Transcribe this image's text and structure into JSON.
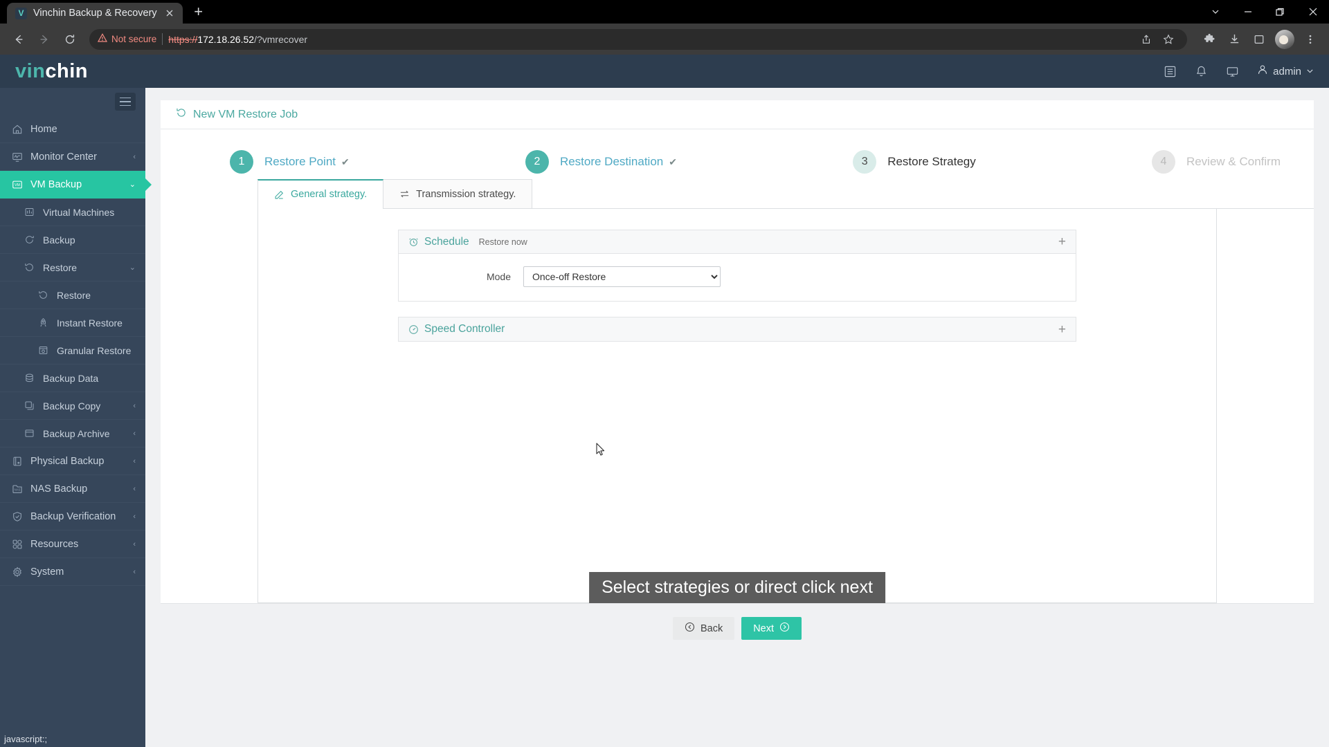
{
  "browser": {
    "tab": {
      "title": "Vinchin Backup & Recovery",
      "favicon_letter": "V",
      "favicon_icon": "vinchin-favicon",
      "close_icon": "close-icon"
    },
    "new_tab_icon": "new-tab-icon",
    "window_controls": {
      "tab_search_icon": "tab-search-icon",
      "minimize_icon": "minimize-icon",
      "maximize_icon": "maximize-icon",
      "close_icon": "window-close-icon"
    },
    "nav": {
      "back_icon": "back-arrow-icon",
      "forward_icon": "forward-arrow-icon",
      "reload_icon": "reload-icon"
    },
    "omnibox": {
      "warning_icon": "not-secure-warning-icon",
      "security_label": "Not secure",
      "url_scheme": "https://",
      "url_host": "172.18.26.52",
      "url_path": "/?vmrecover",
      "share_icon": "share-icon",
      "bookmark_icon": "bookmark-star-icon"
    },
    "toolbar_icons": [
      "extensions-puzzle-icon",
      "downloads-icon",
      "sidepanel-icon",
      "profile-avatar",
      "chrome-menu-icon"
    ]
  },
  "status_bar": {
    "text": "javascript:;"
  },
  "header": {
    "logo_part1": "vin",
    "logo_part2": "chin",
    "icons": [
      "log-list-icon",
      "notification-bell-icon",
      "monitor-display-icon"
    ],
    "user": {
      "avatar_icon": "user-icon",
      "name": "admin",
      "chevron_icon": "chevron-down-icon"
    }
  },
  "sidebar": {
    "toggle_icon": "hamburger-menu-icon",
    "items": [
      {
        "label": "Home",
        "icon": "home-icon",
        "level": 0,
        "caret": "",
        "active": false
      },
      {
        "label": "Monitor Center",
        "icon": "monitor-center-icon",
        "level": 0,
        "caret": "‹",
        "active": false
      },
      {
        "label": "VM Backup",
        "icon": "vm-icon",
        "level": 0,
        "caret": "⌄",
        "active": true
      },
      {
        "label": "Virtual Machines",
        "icon": "virtual-machines-icon",
        "level": 1,
        "caret": "",
        "active": false
      },
      {
        "label": "Backup",
        "icon": "backup-icon",
        "level": 1,
        "caret": "",
        "active": false
      },
      {
        "label": "Restore",
        "icon": "restore-icon",
        "level": 1,
        "caret": "⌄",
        "active": false
      },
      {
        "label": "Restore",
        "icon": "restore-icon",
        "level": 2,
        "caret": "",
        "active": false
      },
      {
        "label": "Instant Restore",
        "icon": "instant-restore-icon",
        "level": 2,
        "caret": "",
        "active": false
      },
      {
        "label": "Granular Restore",
        "icon": "granular-restore-icon",
        "level": 2,
        "caret": "",
        "active": false
      },
      {
        "label": "Backup Data",
        "icon": "backup-data-icon",
        "level": 1,
        "caret": "",
        "active": false
      },
      {
        "label": "Backup Copy",
        "icon": "backup-copy-icon",
        "level": 1,
        "caret": "‹",
        "active": false
      },
      {
        "label": "Backup Archive",
        "icon": "backup-archive-icon",
        "level": 1,
        "caret": "‹",
        "active": false
      },
      {
        "label": "Physical Backup",
        "icon": "physical-backup-icon",
        "level": 0,
        "caret": "‹",
        "active": false
      },
      {
        "label": "NAS Backup",
        "icon": "nas-backup-icon",
        "level": 0,
        "caret": "‹",
        "active": false
      },
      {
        "label": "Backup Verification",
        "icon": "backup-verification-icon",
        "level": 0,
        "caret": "‹",
        "active": false
      },
      {
        "label": "Resources",
        "icon": "resources-icon",
        "level": 0,
        "caret": "‹",
        "active": false
      },
      {
        "label": "System",
        "icon": "system-gear-icon",
        "level": 0,
        "caret": "‹",
        "active": false
      }
    ]
  },
  "page": {
    "title": "New VM Restore Job",
    "title_icon": "restore-icon",
    "steps": [
      {
        "number": "1",
        "label": "Restore Point",
        "state": "done",
        "check": "✔"
      },
      {
        "number": "2",
        "label": "Restore Destination",
        "state": "done",
        "check": "✔"
      },
      {
        "number": "3",
        "label": "Restore Strategy",
        "state": "current",
        "check": ""
      },
      {
        "number": "4",
        "label": "Review & Confirm",
        "state": "todo",
        "check": ""
      }
    ],
    "tabs": [
      {
        "label": "General strategy.",
        "icon": "edit-pencil-icon",
        "active": true
      },
      {
        "label": "Transmission strategy.",
        "icon": "transfer-arrows-icon",
        "active": false
      }
    ],
    "accordions": [
      {
        "title": "Schedule",
        "subtitle": "Restore now",
        "icon": "alarm-clock-icon",
        "expand_icon": "plus-icon",
        "expanded": true,
        "field_label": "Mode",
        "field_value": "Once-off Restore",
        "field_options": [
          "Once-off Restore"
        ]
      },
      {
        "title": "Speed Controller",
        "subtitle": "",
        "icon": "speedometer-icon",
        "expand_icon": "plus-icon",
        "expanded": false
      }
    ],
    "tooltip": "Select strategies or direct click next",
    "buttons": {
      "back": {
        "label": "Back",
        "icon": "arrow-left-circle-icon"
      },
      "next": {
        "label": "Next",
        "icon": "arrow-right-circle-icon"
      }
    }
  },
  "colors": {
    "accent": "#2ec4a6",
    "sidebar_bg": "#36465a",
    "header_bg": "#2d3d4f",
    "link_teal": "#4aa8a0"
  }
}
